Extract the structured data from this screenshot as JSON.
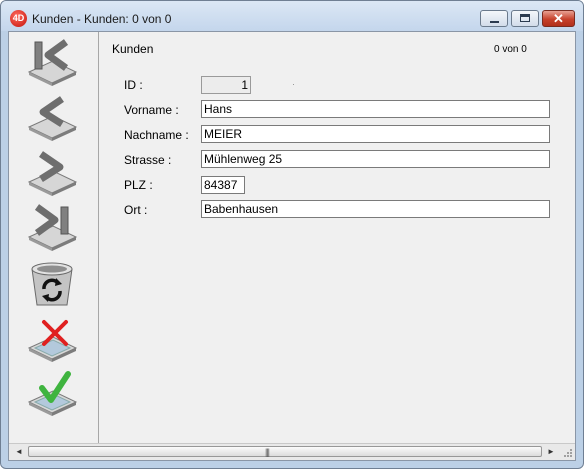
{
  "window": {
    "app_icon_text": "4D",
    "title": "Kunden - Kunden: 0 von 0",
    "close_glyph": "✕"
  },
  "toolbar": {
    "buttons": [
      {
        "name": "first-record-button",
        "icon": "first-record-icon"
      },
      {
        "name": "previous-record-button",
        "icon": "previous-record-icon"
      },
      {
        "name": "next-record-button",
        "icon": "next-record-icon"
      },
      {
        "name": "last-record-button",
        "icon": "last-record-icon"
      },
      {
        "name": "delete-record-button",
        "icon": "trash-icon"
      },
      {
        "name": "cancel-button",
        "icon": "cancel-icon"
      },
      {
        "name": "accept-button",
        "icon": "accept-icon"
      }
    ]
  },
  "form": {
    "heading": "Kunden",
    "counter": "0 von 0",
    "fields": {
      "id": {
        "label": "ID :",
        "value": "1"
      },
      "vorname": {
        "label": "Vorname :",
        "value": "Hans"
      },
      "nachname": {
        "label": "Nachname :",
        "value": "MEIER"
      },
      "strasse": {
        "label": "Strasse :",
        "value": "Mühlenweg 25"
      },
      "plz": {
        "label": "PLZ :",
        "value": "84387"
      },
      "ort": {
        "label": "Ort :",
        "value": "Babenhausen"
      }
    }
  },
  "scrollbar": {
    "left_arrow": "◄",
    "right_arrow": "►",
    "grip": "|||"
  },
  "colors": {
    "title_bar": "#c4d6ec",
    "client_bg": "#f0f0f0",
    "close_button": "#c7412c",
    "accept_check": "#3fb43f",
    "cancel_cross": "#e02020"
  }
}
